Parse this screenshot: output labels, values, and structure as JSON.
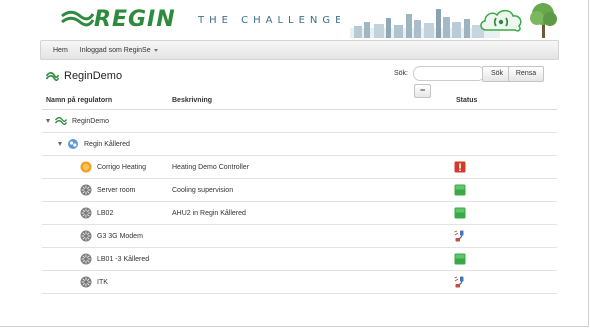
{
  "banner": {
    "logo_text": "REGIN",
    "tagline": "THE CHALLENGER"
  },
  "nav": {
    "home_label": "Hem",
    "user_label": "Inloggad som ReginSe"
  },
  "page": {
    "title": "ReginDemo",
    "search_label": "Sök:",
    "search_value": "",
    "search_button": "Sök",
    "reset_button": "Rensa",
    "collapse_button": "−"
  },
  "table": {
    "columns": [
      "Namn på regulatorn",
      "Beskrivning",
      "Status"
    ],
    "tree": [
      {
        "name": "ReginDemo",
        "level": 0
      },
      {
        "name": "Regin Kållered",
        "level": 1
      }
    ],
    "rows": [
      {
        "name": "Corrigo Heating",
        "description": "Heating Demo Controller",
        "status": "alarm",
        "icon": "corrigo-icon"
      },
      {
        "name": "Server room",
        "description": "Cooling supervision",
        "status": "ok",
        "icon": "controller-icon"
      },
      {
        "name": "LB02",
        "description": "AHU2 in Regin Kållered",
        "status": "ok",
        "icon": "controller-icon"
      },
      {
        "name": "G3 3G Modem",
        "description": "",
        "status": "disconnected",
        "icon": "controller-icon"
      },
      {
        "name": "LB01 -3 Kållered",
        "description": "",
        "status": "ok",
        "icon": "controller-icon"
      },
      {
        "name": "ITK",
        "description": "",
        "status": "disconnected",
        "icon": "controller-icon"
      }
    ]
  },
  "colors": {
    "brand_green": "#2e8b3e",
    "status_ok": "#3aa845",
    "status_alarm": "#d23a2a",
    "corrigo_orange": "#f0a020"
  }
}
